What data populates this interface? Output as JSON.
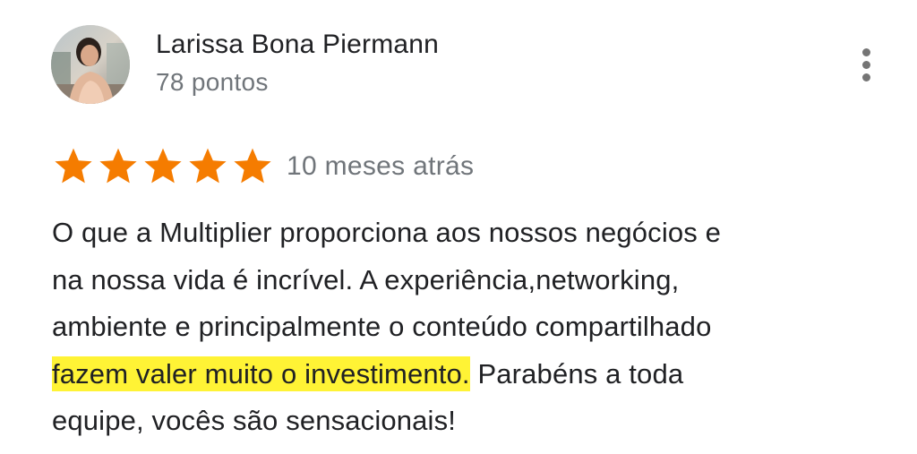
{
  "review": {
    "author": {
      "name": "Larissa Bona Piermann",
      "points": "78 pontos",
      "avatar_icon": "profile-photo"
    },
    "more_options_icon": "more-vert-icon",
    "rating": {
      "stars": 5,
      "max_stars": 5,
      "star_color": "#F57C00",
      "date": "10 meses atrás"
    },
    "text_lines": [
      "O que a Multiplier proporciona aos nossos negócios e",
      "na nossa vida é incrível. A experiência,networking,",
      "ambiente e principalmente o conteúdo compartilhado"
    ],
    "highlighted_text": "fazem valer muito o investimento.",
    "highlight_color": "#FFF335",
    "after_highlight": " Parabéns a toda",
    "last_line": "equipe, vocês são sensacionais!"
  }
}
